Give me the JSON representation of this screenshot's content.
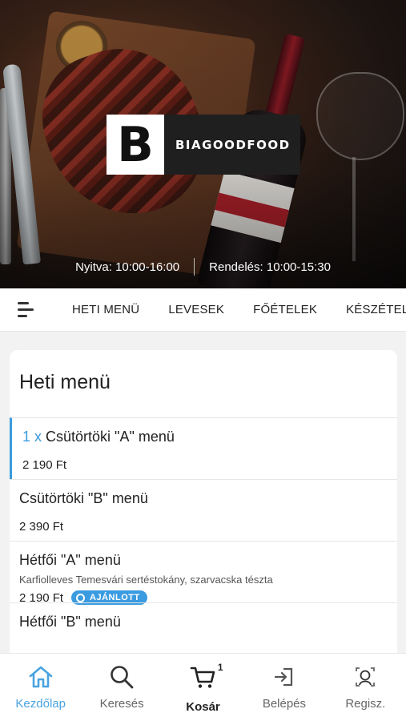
{
  "hero": {
    "brand": "BIAGOODFOOD",
    "logo_letter": "B",
    "open_hours": "Nyitva: 10:00-16:00",
    "order_hours": "Rendelés: 10:00-15:30"
  },
  "categories": [
    "HETI MENÜ",
    "LEVESEK",
    "FŐÉTELEK",
    "KÉSZÉTELE"
  ],
  "section": {
    "title": "Heti menü",
    "items": [
      {
        "qty": "1 x",
        "name": "Csütörtöki \"A\" menü",
        "price": "2 190 Ft"
      },
      {
        "name": "Csütörtöki \"B\" menü",
        "price": "2 390 Ft"
      },
      {
        "name": "Hétfői \"A\" menü",
        "desc": "Karfiolleves Temesvári sertéstokány, szarvacska tészta",
        "price": "2 190 Ft",
        "badge": "AJÁNLOTT"
      },
      {
        "name": "Hétfői \"B\" menü"
      }
    ]
  },
  "bottom_nav": {
    "home": "Kezdőlap",
    "search": "Keresés",
    "cart": "Kosár",
    "cart_count": "1",
    "login": "Belépés",
    "register": "Regisz."
  },
  "colors": {
    "accent": "#3a9be0",
    "hero_dark": "#1f1f1f"
  }
}
